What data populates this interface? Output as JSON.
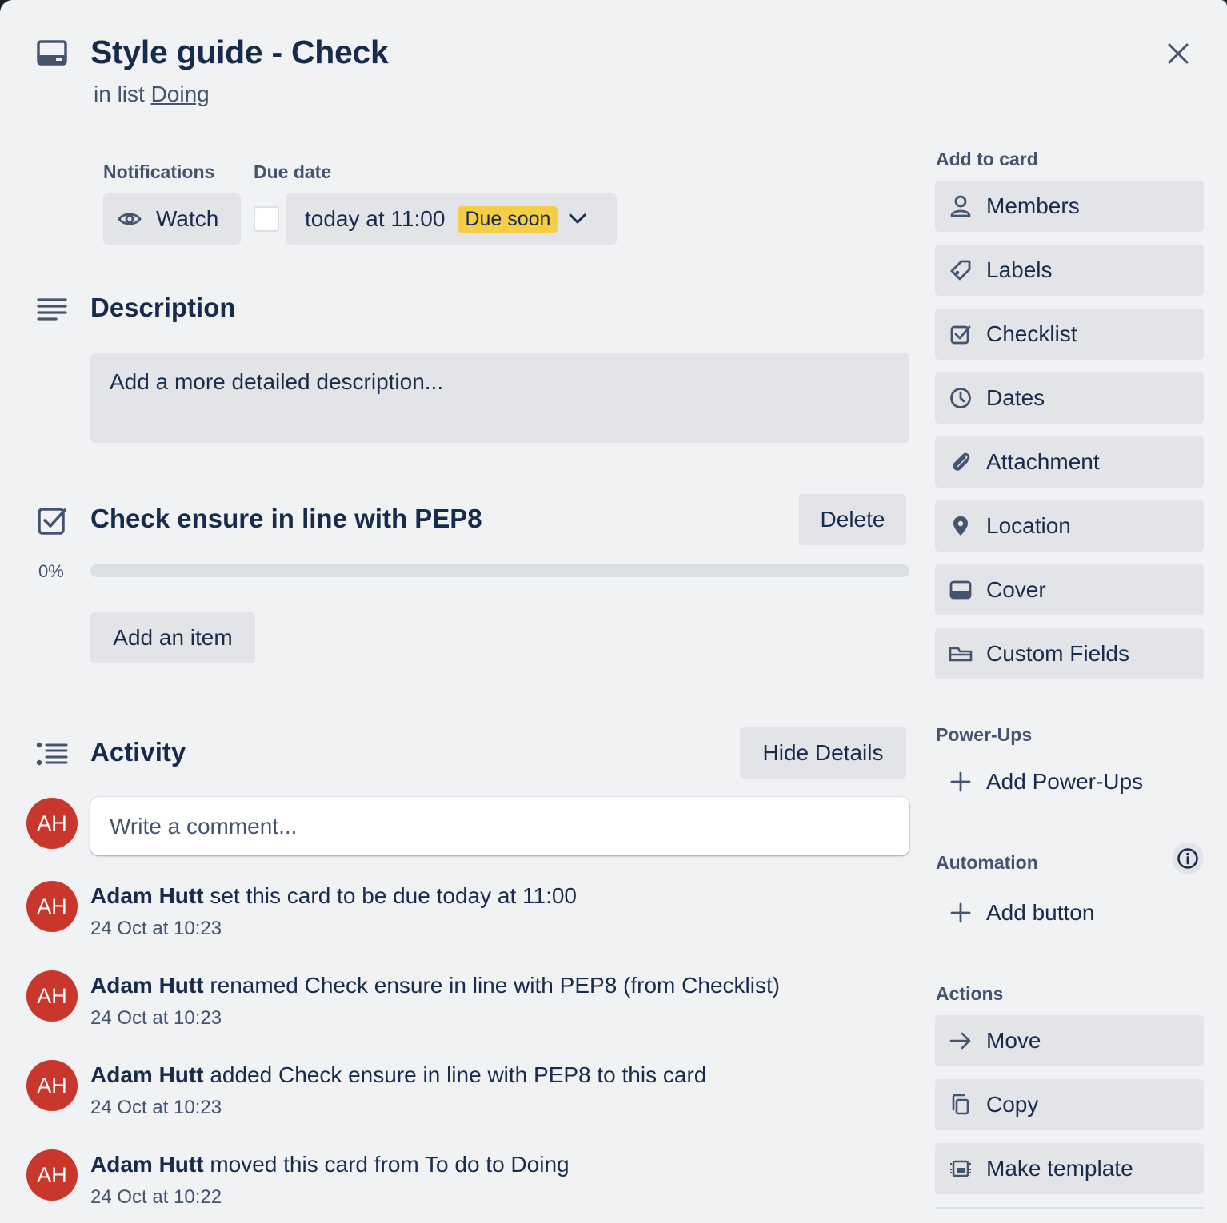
{
  "card": {
    "title": "Style guide - Check",
    "list_prefix": "in list ",
    "list_name": "Doing"
  },
  "notifications": {
    "label": "Notifications",
    "watch_label": "Watch"
  },
  "due": {
    "label": "Due date",
    "value": "today at 11:00",
    "badge": "Due soon",
    "badge_color": "#f5cd47",
    "completed": false
  },
  "description": {
    "title": "Description",
    "placeholder": "Add a more detailed description..."
  },
  "checklist": {
    "title": "Check ensure in line with PEP8",
    "delete_label": "Delete",
    "percent_label": "0%",
    "progress": 0,
    "add_item_label": "Add an item"
  },
  "activity": {
    "title": "Activity",
    "hide_details_label": "Hide Details",
    "comment_placeholder": "Write a comment...",
    "user_initials": "AH",
    "avatar_color": "#c9372c",
    "entries": [
      {
        "user": "Adam Hutt",
        "text": " set this card to be due today at 11:00",
        "time": "24 Oct at 10:23",
        "initials": "AH"
      },
      {
        "user": "Adam Hutt",
        "text": " renamed Check ensure in line with PEP8 (from Checklist)",
        "time": "24 Oct at 10:23",
        "initials": "AH"
      },
      {
        "user": "Adam Hutt",
        "text": " added Check ensure in line with PEP8 to this card",
        "time": "24 Oct at 10:23",
        "initials": "AH"
      },
      {
        "user": "Adam Hutt",
        "text": " moved this card from To do to Doing",
        "time": "24 Oct at 10:22",
        "initials": "AH"
      }
    ]
  },
  "sidebar": {
    "add_to_card_title": "Add to card",
    "add_to_card": [
      {
        "label": "Members",
        "icon": "person-icon"
      },
      {
        "label": "Labels",
        "icon": "tag-icon"
      },
      {
        "label": "Checklist",
        "icon": "checklist-icon"
      },
      {
        "label": "Dates",
        "icon": "clock-icon"
      },
      {
        "label": "Attachment",
        "icon": "paperclip-icon"
      },
      {
        "label": "Location",
        "icon": "location-pin-icon"
      },
      {
        "label": "Cover",
        "icon": "cover-icon"
      },
      {
        "label": "Custom Fields",
        "icon": "custom-fields-icon"
      }
    ],
    "power_ups_title": "Power-Ups",
    "add_power_ups_label": "Add Power-Ups",
    "automation_title": "Automation",
    "add_button_label": "Add button",
    "actions_title": "Actions",
    "actions": [
      {
        "label": "Move",
        "icon": "arrow-right-icon"
      },
      {
        "label": "Copy",
        "icon": "copy-icon"
      },
      {
        "label": "Make template",
        "icon": "template-icon"
      }
    ]
  }
}
